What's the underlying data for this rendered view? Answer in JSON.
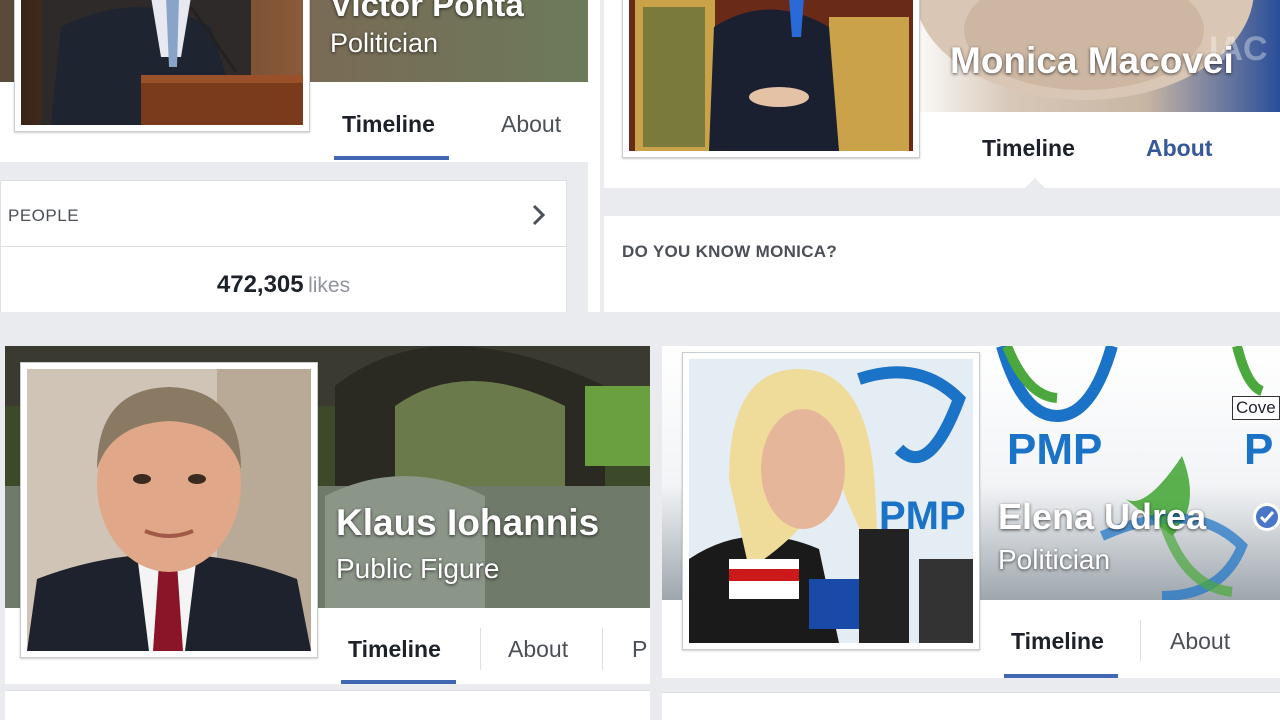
{
  "profiles": {
    "top_left": {
      "name": "Victor Ponta",
      "category": "Politician",
      "tabs": [
        "Timeline",
        "About"
      ],
      "people_header": "PEOPLE",
      "likes_count": "472,305",
      "likes_label": "likes"
    },
    "top_right": {
      "name": "Monica Macovei",
      "tabs": [
        "Timeline",
        "About"
      ],
      "section_header": "DO YOU KNOW MONICA?"
    },
    "bottom_left": {
      "name": "Klaus Iohannis",
      "category": "Public Figure",
      "tabs": [
        "Timeline",
        "About",
        "P"
      ]
    },
    "bottom_right": {
      "name": "Elena Udrea",
      "category": "Politician",
      "tabs": [
        "Timeline",
        "About"
      ],
      "cover_tooltip": "Cove",
      "cover_logo_text": "PMP",
      "photo_logo_text": "PMP"
    }
  },
  "colors": {
    "accent": "#4267b2",
    "link_blue": "#365899",
    "pmp_blue": "#1a73c7",
    "pmp_green": "#4aa83c"
  }
}
